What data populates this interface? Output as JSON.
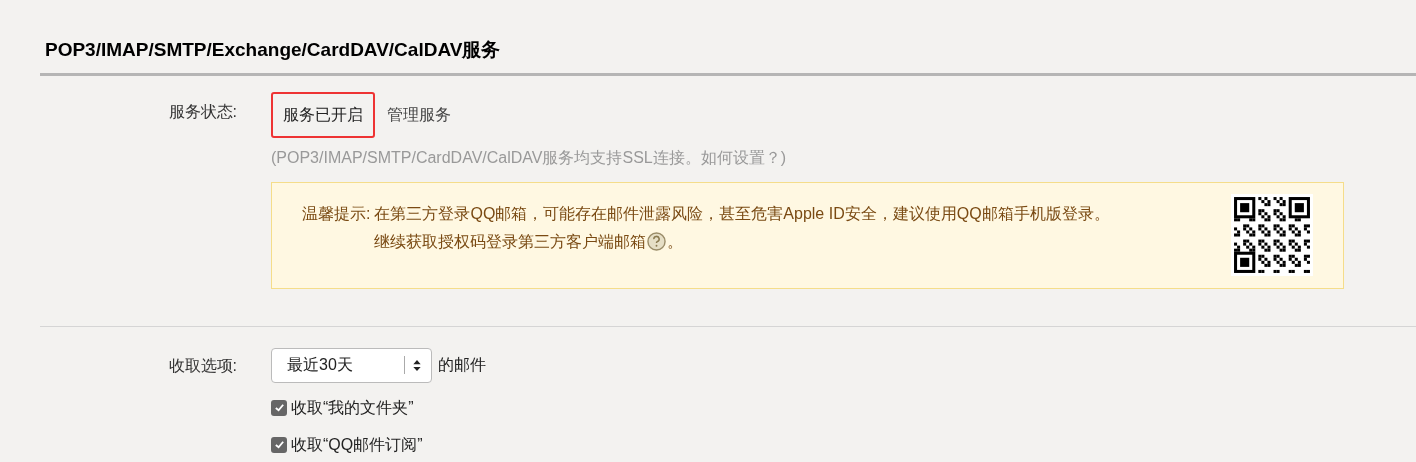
{
  "section_title": "POP3/IMAP/SMTP/Exchange/CardDAV/CalDAV服务",
  "service_status": {
    "label": "服务状态:",
    "status": "服务已开启",
    "highlighted": true,
    "manage_link": "管理服务"
  },
  "ssl_note": "(POP3/IMAP/SMTP/CardDAV/CalDAV服务均支持SSL连接。如何设置？)",
  "notice": {
    "label": "温馨提示:",
    "line_1": "在第三方登录QQ邮箱，可能存在邮件泄露风险，甚至危害Apple ID安全，建议使用QQ邮箱手机版登录。",
    "line_2": "继续获取授权码登录第三方客户端邮箱",
    "line_2_end": "。"
  },
  "fetch_options": {
    "label": "收取选项:",
    "select_value": "最近30天",
    "suffix": "的邮件",
    "checkboxes": [
      {
        "label": "收取“我的文件夹”",
        "checked": true
      },
      {
        "label": "收取“QQ邮件订阅”",
        "checked": true
      }
    ]
  }
}
